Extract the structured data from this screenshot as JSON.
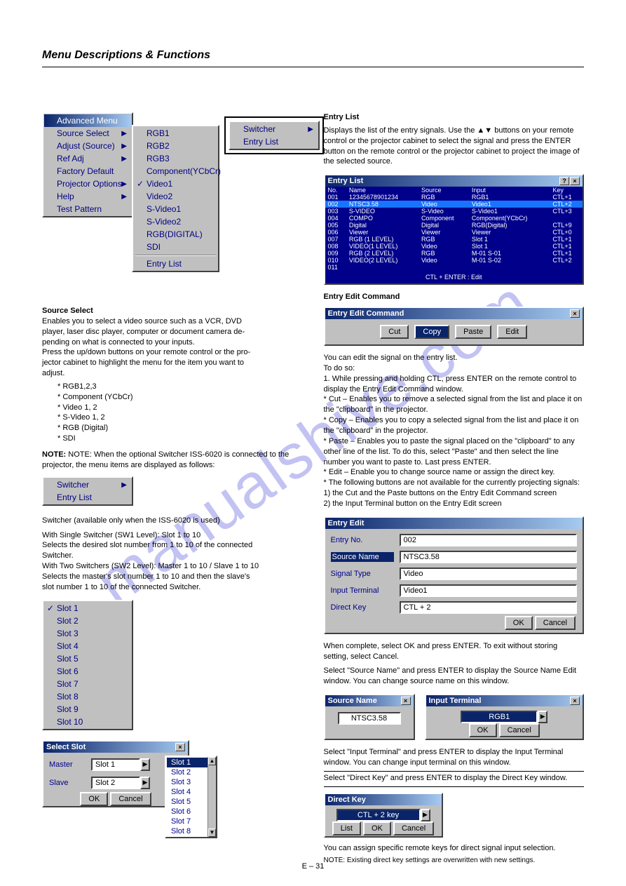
{
  "page": {
    "title": "Menu Descriptions & Functions",
    "footer": "E – 31"
  },
  "watermark": "manualshive.com",
  "heading": "Source Select",
  "intro_lines": [
    "Enables you to select a video source such as a VCR, DVD",
    "player, laser disc player, computer or document camera de-",
    "pending on what is connected to your inputs.",
    "Press the up/down buttons on your remote control or the pro-",
    "jector cabinet to highlight the menu for the item you want to",
    "adjust."
  ],
  "standalone_inputs": [
    "RGB1,2,3",
    "Component (YCbCr)",
    "Video 1, 2",
    "S-Video 1, 2",
    "RGB (Digital)",
    "SDI"
  ],
  "advanced_menu": {
    "title": "Advanced Menu",
    "items": [
      {
        "label": "Source Select",
        "arrow": true
      },
      {
        "label": "Adjust (Source)",
        "arrow": true
      },
      {
        "label": "Ref Adj",
        "arrow": true
      },
      {
        "label": "Factory Default"
      },
      {
        "label": "Projector Options",
        "arrow": true
      },
      {
        "label": "Help",
        "arrow": true
      },
      {
        "label": "Test Pattern"
      }
    ]
  },
  "src_submenu": [
    "RGB1",
    "RGB2",
    "RGB3",
    "Component(YCbCr)",
    "Video1",
    "Video2",
    "S-Video1",
    "S-Video2",
    "RGB(DIGITAL)",
    "SDI",
    "Entry List"
  ],
  "src_submenu_checked": "Video1",
  "swel_box": [
    "Switcher",
    "Entry List"
  ],
  "mode_note": "NOTE: When the optional Switcher ISS-6020 is connected to the projector, the menu items are displayed as follows:",
  "sw_menu": {
    "top": "Switcher",
    "sub": "Entry List"
  },
  "slot_box": {
    "title": "Select Slot",
    "master_lbl": "Master",
    "slave_lbl": "Slave",
    "master_val": "Slot 1",
    "slave_val": "Slot 2",
    "ok": "OK",
    "cancel": "Cancel"
  },
  "sw_levels": {
    "intro": "Switcher (available only when the ISS-6020 is used)"
  },
  "slot_items": [
    "Slot 1",
    "Slot 2",
    "Slot 3",
    "Slot 4",
    "Slot 5",
    "Slot 6",
    "Slot 7",
    "Slot 8",
    "Slot 9",
    "Slot 10"
  ],
  "slot_pop": [
    "Slot 1",
    "Slot 2",
    "Slot 3",
    "Slot 4",
    "Slot 5",
    "Slot 6",
    "Slot 7",
    "Slot 8"
  ],
  "left_level_text": [
    "With Single Switcher (SW1 Level): Slot 1 to 10",
    "Selects the desired slot number from 1 to 10 of the connected",
    "Switcher.",
    "With Two Switchers (SW2 Level): Master 1 to 10 / Slave 1 to 10",
    "Selects the master's slot number 1 to 10 and then the slave's",
    "slot number 1 to 10 of the connected Switcher."
  ],
  "entry_heading": "Entry List",
  "entry_intro": "Displays the list of the entry signals. Use the ▲▼ buttons on your remote control or the projector cabinet to select the signal and press the ENTER button on the remote control or the projector cabinet to project the image of the selected source.",
  "entry_list": {
    "title": "Entry List",
    "cols": [
      "No.",
      "Name",
      "Source",
      "Input",
      "Key"
    ],
    "rows": [
      [
        "001",
        "12345678901234",
        "RGB",
        "RGB1",
        "CTL+1"
      ],
      [
        "002",
        "NTSC3.58",
        "Video",
        "Video1",
        "CTL+2"
      ],
      [
        "003",
        "S-VIDEO",
        "S-Video",
        "S-Video1",
        "CTL+3"
      ],
      [
        "004",
        "COMPO",
        "Component",
        "Component(YCbCr)",
        ""
      ],
      [
        "005",
        "Digital",
        "Digital",
        "RGB(Digital)",
        "CTL+9"
      ],
      [
        "006",
        "Viewer",
        "Viewer",
        "Viewer",
        "CTL+0"
      ],
      [
        "007",
        "RGB (1 LEVEL)",
        "RGB",
        "Slot 1",
        "CTL+1"
      ],
      [
        "008",
        "VIDEO(1 LEVEL)",
        "Video",
        "Slot 1",
        "CTL+1"
      ],
      [
        "009",
        "RGB (2 LEVEL)",
        "RGB",
        "M-01 S-01",
        "CTL+1"
      ],
      [
        "010",
        "VIDEO(2 LEVEL)",
        "Video",
        "M-01 S-02",
        "CTL+2"
      ],
      [
        "011",
        "",
        "",
        "",
        ""
      ]
    ],
    "footer": "CTL + ENTER : Edit"
  },
  "edit_cmd": {
    "title": "Entry Edit Command",
    "btns": [
      "Cut",
      "Copy",
      "Paste",
      "Edit"
    ],
    "sel": "Copy"
  },
  "edit_desc": [
    "You can edit the signal on the entry list.",
    "To do so:",
    "1. While pressing and holding CTL, press ENTER on the remote control to display the Entry Edit Command window.",
    "* Cut – Enables you to remove a selected signal from the list and place it on the \"clipboard\" in the projector.",
    "* Copy – Enables you to copy a selected signal from the list and place it on the \"clipboard\" in the projector.",
    "* Paste – Enables you to paste the signal placed on the \"clipboard\" to any other line of the list. To do this, select \"Paste\" and then select the line number you want to paste to. Last press ENTER.",
    "* Edit – Enable you to change source name or assign the direct key.",
    "* The following buttons are not available for the currently projecting signals:",
    "  1) the Cut and the Paste buttons on the Entry Edit Command screen",
    "  2) the Input Terminal button on the Entry Edit screen"
  ],
  "entry_edit": {
    "title": "Entry Edit",
    "rows": [
      {
        "k": "Entry No.",
        "v": "002"
      },
      {
        "k": "Source Name",
        "v": "NTSC3.58",
        "sel": true
      },
      {
        "k": "Signal Type",
        "v": "Video"
      },
      {
        "k": "Input Terminal",
        "v": "Video1"
      },
      {
        "k": "Direct Key",
        "v": "CTL + 2"
      }
    ],
    "ok": "OK",
    "cancel": "Cancel"
  },
  "when_edit": "When complete, select OK and press ENTER. To exit without storing setting, select Cancel.",
  "src_name_dlg": {
    "title": "Source Name",
    "val": "NTSC3.58"
  },
  "src_name_txt": "Select \"Source Name\" and press ENTER to display the Source Name Edit window. You can change source name on this window.",
  "input_term_dlg": {
    "title": "Input Terminal",
    "val": "RGB1",
    "ok": "OK",
    "cancel": "Cancel"
  },
  "input_term_txt": "Select \"Input Terminal\" and press ENTER to display the Input Terminal window. You can change input terminal on this window.",
  "direct_key_dlg": {
    "title": "Direct Key",
    "val": "CTL + 2 key",
    "list": "List",
    "ok": "OK",
    "cancel": "Cancel"
  },
  "direct_key_txt": "Select \"Direct Key\" and press ENTER to display the Direct Key window.",
  "direct_key_txt2": "You can assign specific remote keys for direct signal input selection.",
  "direct_key_note": "NOTE: Existing direct key settings are overwritten with new settings."
}
